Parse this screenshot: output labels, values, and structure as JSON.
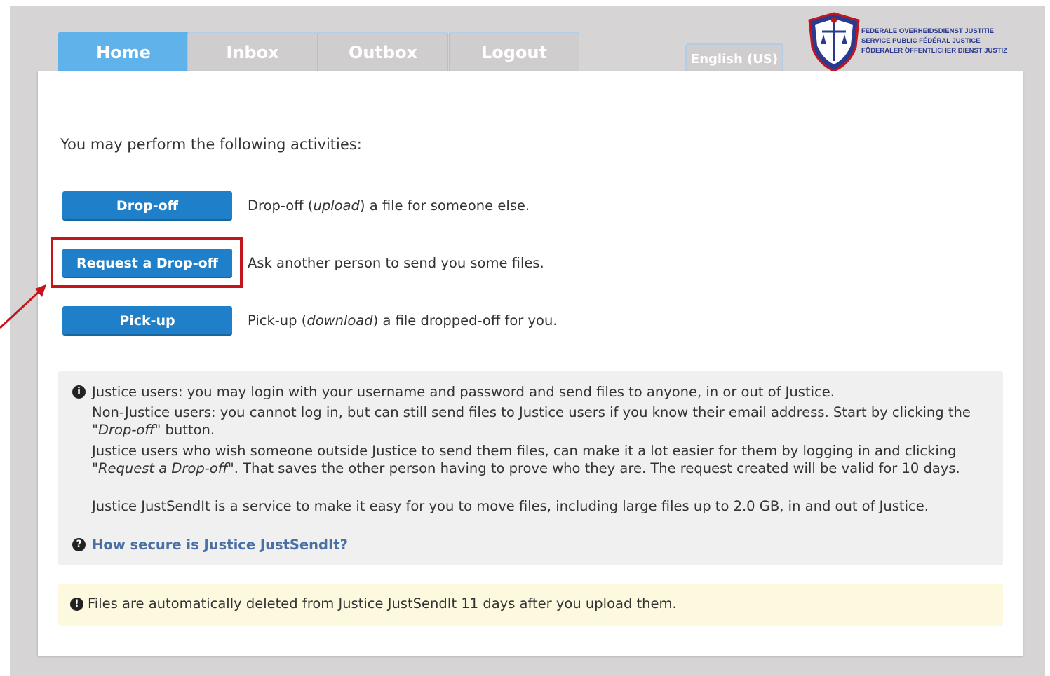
{
  "tabs": [
    {
      "label": "Home",
      "active": true
    },
    {
      "label": "Inbox",
      "active": false
    },
    {
      "label": "Outbox",
      "active": false
    },
    {
      "label": "Logout",
      "active": false
    }
  ],
  "language": "English (US)",
  "logo": {
    "lines": [
      "Federale Overheidsdienst Justitie",
      "Service Public Fédéral Justice",
      "Föderaler Öffentlicher Dienst Justiz"
    ]
  },
  "intro": "You may perform the following activities:",
  "actions": [
    {
      "button": "Drop-off",
      "desc_before": "Drop-off (",
      "desc_italic": "upload",
      "desc_after": ") a file for someone else."
    },
    {
      "button": "Request a Drop-off",
      "desc_before": "Ask another person to send you some files.",
      "desc_italic": "",
      "desc_after": ""
    },
    {
      "button": "Pick-up",
      "desc_before": "Pick-up (",
      "desc_italic": "download",
      "desc_after": ") a file dropped-off for you."
    }
  ],
  "info": {
    "line1": "Justice users: you may login with your username and password and send files to anyone, in or out of Justice.",
    "line2_before": "Non-Justice users: you cannot log in, but can still send files to Justice users if you know their email address. Start by clicking the \"",
    "line2_italic": "Drop-off",
    "line2_after": "\" button.",
    "line3_before": "Justice users who wish someone outside Justice to send them files, can make it a lot easier for them by logging in and clicking \"",
    "line3_italic": "Request a Drop-off",
    "line3_after": "\". That saves the other person having to prove who they are. The request created will be valid for 10 days.",
    "line4": "Justice JustSendIt is a service to make it easy for you to move files, including large files up to 2.0 GB, in and out of Justice.",
    "link": "How secure is Justice JustSendIt?"
  },
  "warning": "Files are automatically deleted from Justice JustSendIt 11 days after you upload them.",
  "colors": {
    "accent": "#1f7fc8",
    "tab_active": "#5fb3ea",
    "highlight": "#c4151c"
  }
}
